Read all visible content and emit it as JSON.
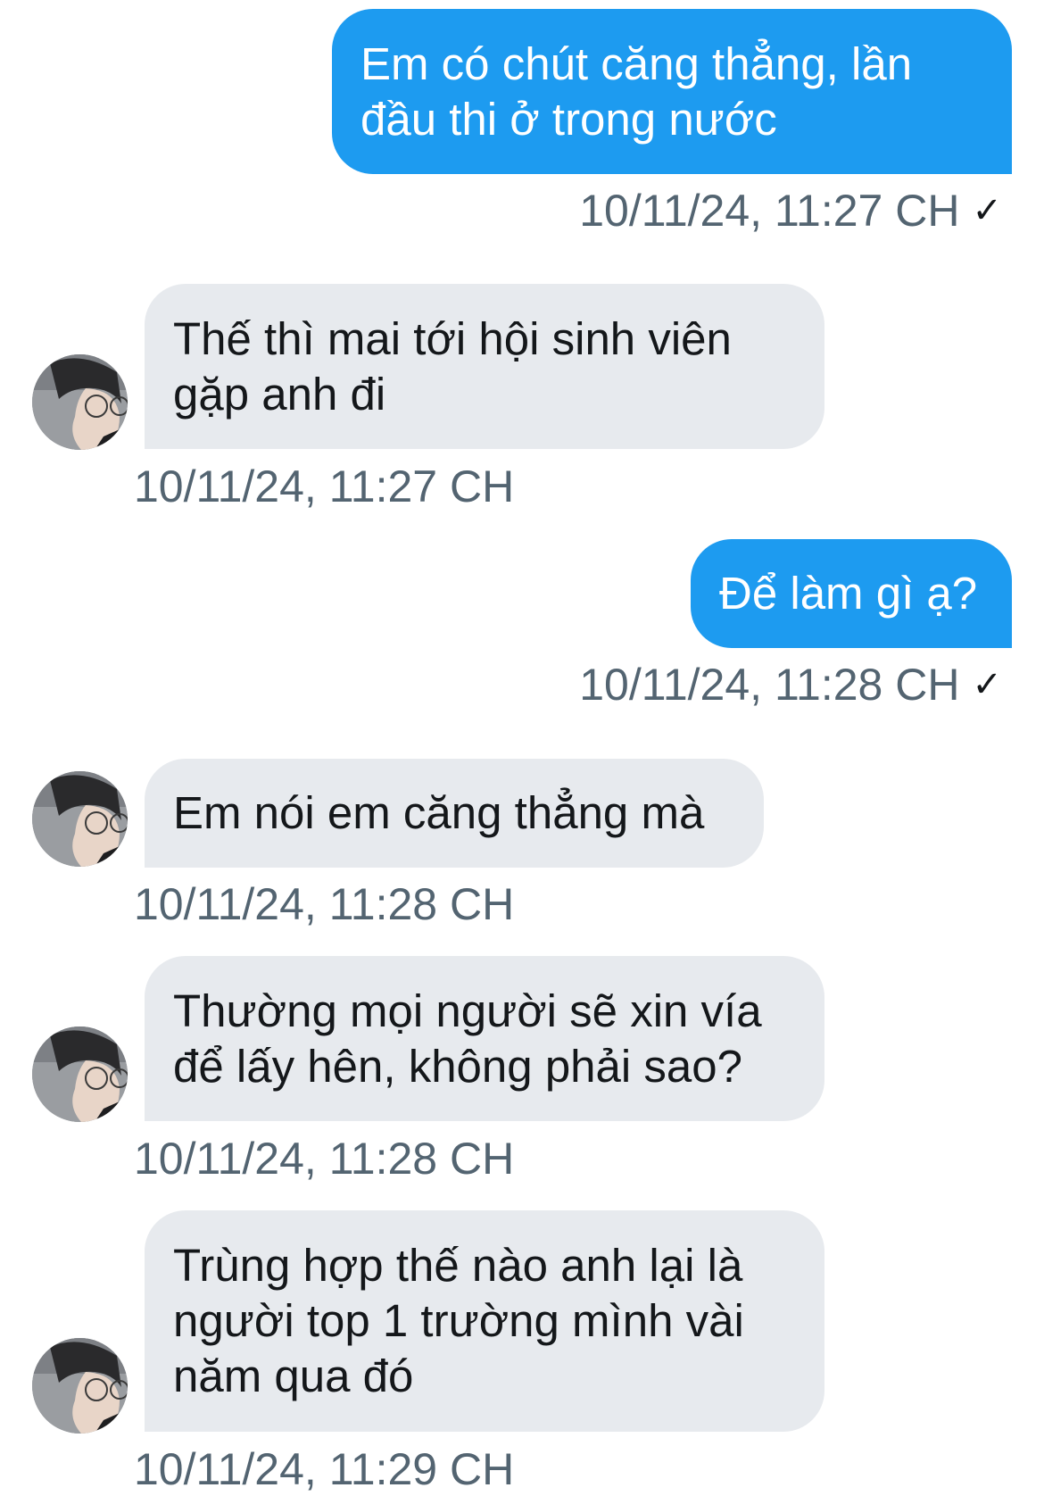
{
  "conversation": {
    "messages": [
      {
        "direction": "outgoing",
        "text": "Em có chút căng thẳng, lần\nđầu thi ở trong nước",
        "time": "10/11/24, 11:27 CH",
        "read": true
      },
      {
        "direction": "incoming",
        "text": "Thế thì mai tới hội sinh viên\ngặp anh đi",
        "time": "10/11/24, 11:27 CH"
      },
      {
        "direction": "outgoing",
        "text": "Để làm gì ạ?",
        "time": "10/11/24, 11:28 CH",
        "read": true
      },
      {
        "direction": "incoming",
        "text": "Em nói em căng thẳng mà",
        "time": "10/11/24, 11:28 CH"
      },
      {
        "direction": "incoming",
        "text": "Thường mọi người sẽ xin vía\nđể lấy hên, không phải sao?",
        "time": "10/11/24, 11:28 CH"
      },
      {
        "direction": "incoming",
        "text": "Trùng hợp thế nào anh lại là\nngười top 1 trường mình vài\nnăm qua đó",
        "time": "10/11/24, 11:29 CH"
      }
    ],
    "read_indicator": "✓"
  },
  "colors": {
    "outgoing_bubble": "#1d9bf0",
    "incoming_bubble": "#e7eaee",
    "timestamp": "#536471"
  },
  "icons": {
    "avatar": "user-avatar-photo",
    "read_receipt": "check-icon"
  }
}
